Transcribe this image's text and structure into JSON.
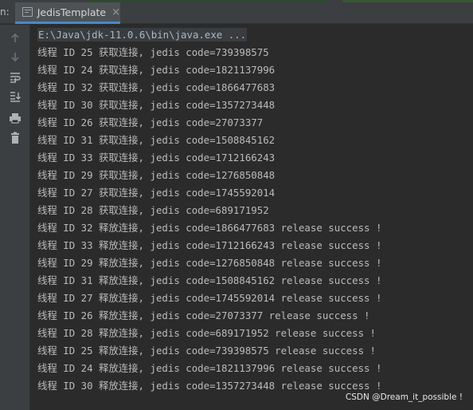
{
  "tabbar": {
    "prefix": "n:",
    "tab_label": "JedisTemplate",
    "close_glyph": "×"
  },
  "toolbar": {
    "icons": [
      "up-arrow-icon",
      "down-arrow-icon",
      "soft-wrap-icon",
      "scroll-to-end-icon",
      "print-icon",
      "trash-icon"
    ]
  },
  "console": {
    "command": "E:\\Java\\jdk-11.0.6\\bin\\java.exe ...",
    "lines": [
      "线程 ID 25 获取连接, jedis code=739398575",
      "线程 ID 24 获取连接, jedis code=1821137996",
      "线程 ID 32 获取连接, jedis code=1866477683",
      "线程 ID 30 获取连接, jedis code=1357273448",
      "线程 ID 26 获取连接, jedis code=27073377",
      "线程 ID 31 获取连接, jedis code=1508845162",
      "线程 ID 33 获取连接, jedis code=1712166243",
      "线程 ID 29 获取连接, jedis code=1276850848",
      "线程 ID 27 获取连接, jedis code=1745592014",
      "线程 ID 28 获取连接, jedis code=689171952",
      "线程 ID 32 释放连接, jedis code=1866477683 release success !",
      "线程 ID 33 释放连接, jedis code=1712166243 release success !",
      "线程 ID 29 释放连接, jedis code=1276850848 release success !",
      "线程 ID 31 释放连接, jedis code=1508845162 release success !",
      "线程 ID 27 释放连接, jedis code=1745592014 release success !",
      "线程 ID 26 释放连接, jedis code=27073377 release success !",
      "线程 ID 28 释放连接, jedis code=689171952 release success !",
      "线程 ID 25 释放连接, jedis code=739398575 release success !",
      "线程 ID 24 释放连接, jedis code=1821137996 release success !",
      "线程 ID 30 释放连接, jedis code=1357273448 release success !"
    ]
  },
  "watermark": "CSDN @Dream_it_possible !",
  "colors": {
    "background": "#2b2b2b",
    "panel": "#3c3f41",
    "text": "#bbbbbb",
    "tab_underline": "#4a88c7"
  }
}
